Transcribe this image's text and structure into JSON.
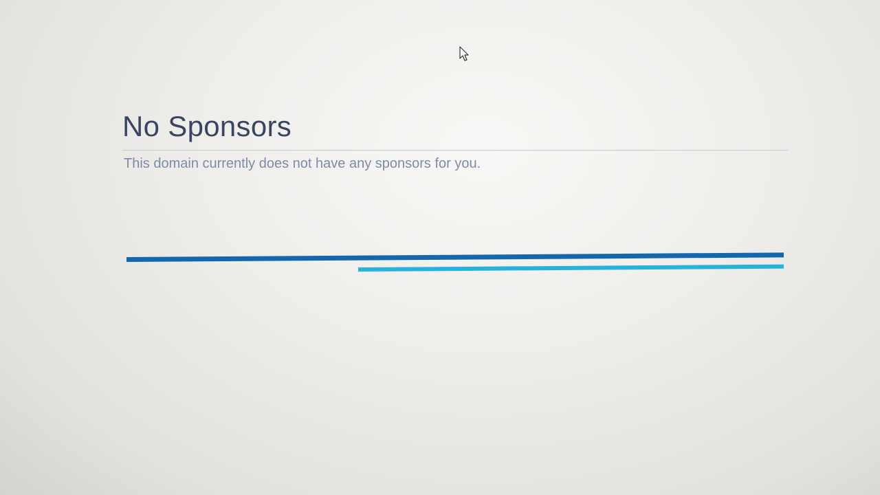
{
  "page": {
    "title": "No Sponsors",
    "message": "This domain currently does not have any sponsors for you."
  },
  "icons": {
    "cursor": "mouse-pointer-icon"
  },
  "colors": {
    "title": "#3a4562",
    "message": "#7e8aa8",
    "primary_bar": "#1567ad",
    "secondary_bar": "#26b2da"
  }
}
